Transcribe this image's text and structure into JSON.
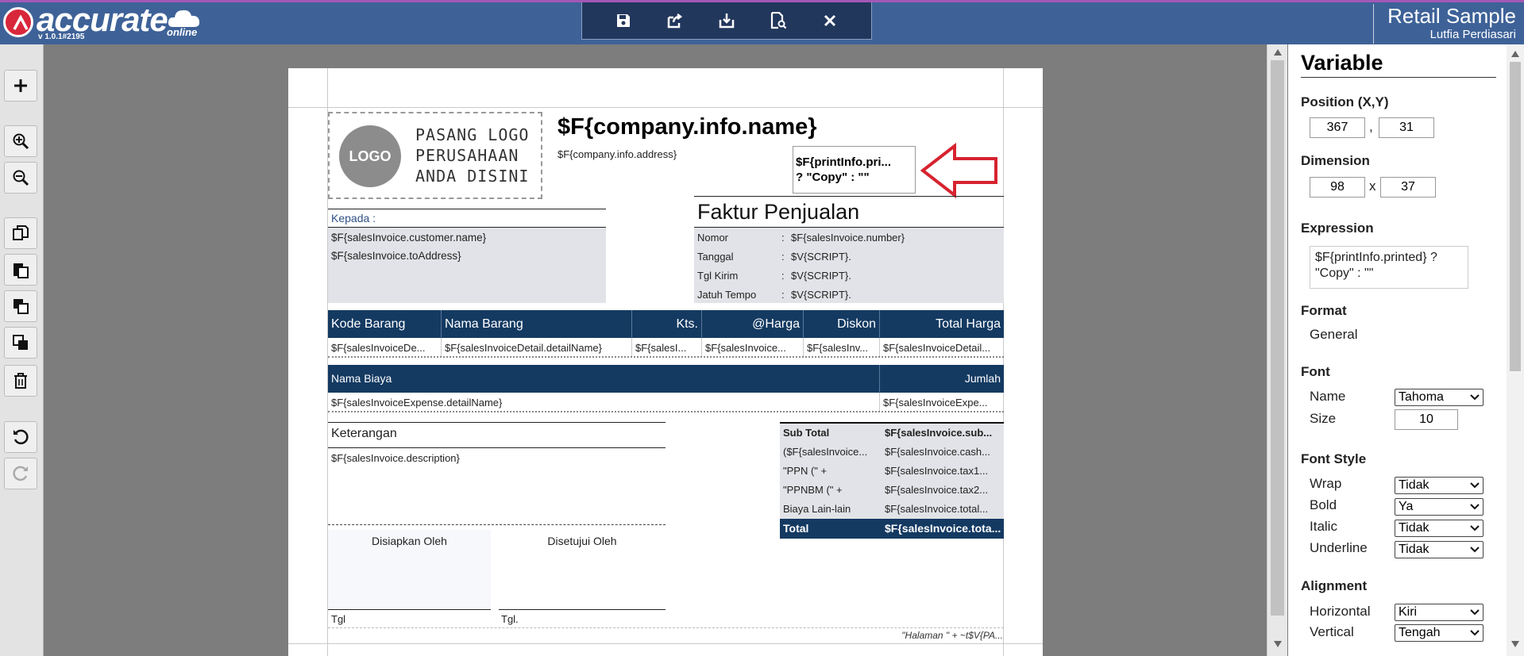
{
  "app": {
    "logo_word": "accurate",
    "logo_online": "online",
    "version": "v 1.0.1#2195",
    "company": "Retail Sample",
    "user": "Lutfia Perdiasari"
  },
  "toolbar": {
    "buttons": [
      "save-icon",
      "export-icon",
      "import-icon",
      "preview-icon",
      "close-icon"
    ]
  },
  "left_tools": [
    "add-icon",
    "zoom-in-icon",
    "zoom-out-icon",
    "copy-icon",
    "paste-icon",
    "bring-front-icon",
    "send-back-icon",
    "delete-icon",
    "undo-icon",
    "redo-icon"
  ],
  "report": {
    "logo_text": "LOGO",
    "logo_hint": [
      "PASANG LOGO",
      "PERUSAHAAN",
      "ANDA DISINI"
    ],
    "company_name": "$F{company.info.name}",
    "company_address": "$F{company.info.address}",
    "selected_expr_1": "$F{printInfo.pri...",
    "selected_expr_2": "? \"Copy\" : \"\"",
    "kepada_label": "Kepada :",
    "customer_name": "$F{salesInvoice.customer.name}",
    "to_address": "$F{salesInvoice.toAddress}",
    "invoice_title": "Faktur Penjualan",
    "info_rows": [
      {
        "label": "Nomor",
        "sep": ":",
        "value": "$F{salesInvoice.number}"
      },
      {
        "label": "Tanggal",
        "sep": ":",
        "value": "$V{SCRIPT}."
      },
      {
        "label": "Tgl Kirim",
        "sep": ":",
        "value": "$V{SCRIPT}."
      },
      {
        "label": "Jatuh Tempo",
        "sep": ":",
        "value": "$V{SCRIPT}."
      }
    ],
    "detail_headers": [
      "Kode Barang",
      "Nama Barang",
      "Kts.",
      "@Harga",
      "Diskon",
      "Total Harga"
    ],
    "detail_values": [
      "$F{salesInvoiceDe...",
      "$F{salesInvoiceDetail.detailName}",
      "$F{salesI...",
      "$F{salesInvoice...",
      "$F{salesInv...",
      "$F{salesInvoiceDetail..."
    ],
    "expense_headers": [
      "Nama Biaya",
      "Jumlah"
    ],
    "expense_values": [
      "$F{salesInvoiceExpense.detailName}",
      "$F{salesInvoiceExpe..."
    ],
    "keterangan_label": "Keterangan",
    "description": "$F{salesInvoice.description}",
    "prepared_by": "Disiapkan Oleh",
    "approved_by": "Disetujui Oleh",
    "tgl1": "Tgl",
    "tgl2": "Tgl.",
    "totals": [
      {
        "label": "Sub Total",
        "value": "$F{salesInvoice.sub..."
      },
      {
        "label": "($F{salesInvoice...",
        "value": "$F{salesInvoice.cash..."
      },
      {
        "label": "\"PPN (\" +",
        "value": "$F{salesInvoice.tax1..."
      },
      {
        "label": "\"PPNBM (\" +",
        "value": "$F{salesInvoice.tax2..."
      },
      {
        "label": "Biaya Lain-lain",
        "value": "$F{salesInvoice.total..."
      }
    ],
    "total_label": "Total",
    "total_value": "$F{salesInvoice.tota...",
    "footer": "\"Halaman \" +  ~t$V{PA..."
  },
  "panel": {
    "title": "Variable",
    "position_label": "Position (X,Y)",
    "pos_x": "367",
    "pos_sep": ",",
    "pos_y": "31",
    "dimension_label": "Dimension",
    "dim_w": "98",
    "dim_sep": "x",
    "dim_h": "37",
    "expression_label": "Expression",
    "expression": "$F{printInfo.printed} ? \"Copy\" : \"\"",
    "format_label": "Format",
    "format_value": "General",
    "font_label": "Font",
    "name_label": "Name",
    "name_value": "Tahoma",
    "size_label": "Size",
    "size_value": "10",
    "font_style_label": "Font Style",
    "wrap_label": "Wrap",
    "wrap_value": "Tidak",
    "bold_label": "Bold",
    "bold_value": "Ya",
    "italic_label": "Italic",
    "italic_value": "Tidak",
    "underline_label": "Underline",
    "underline_value": "Tidak",
    "alignment_label": "Alignment",
    "horizontal_label": "Horizontal",
    "horizontal_value": "Kiri",
    "vertical_label": "Vertical",
    "vertical_value": "Tengah"
  },
  "colors": {
    "topbar": "#3e6298",
    "header_row": "#143a62",
    "highlight_arrow": "#d6232f"
  }
}
